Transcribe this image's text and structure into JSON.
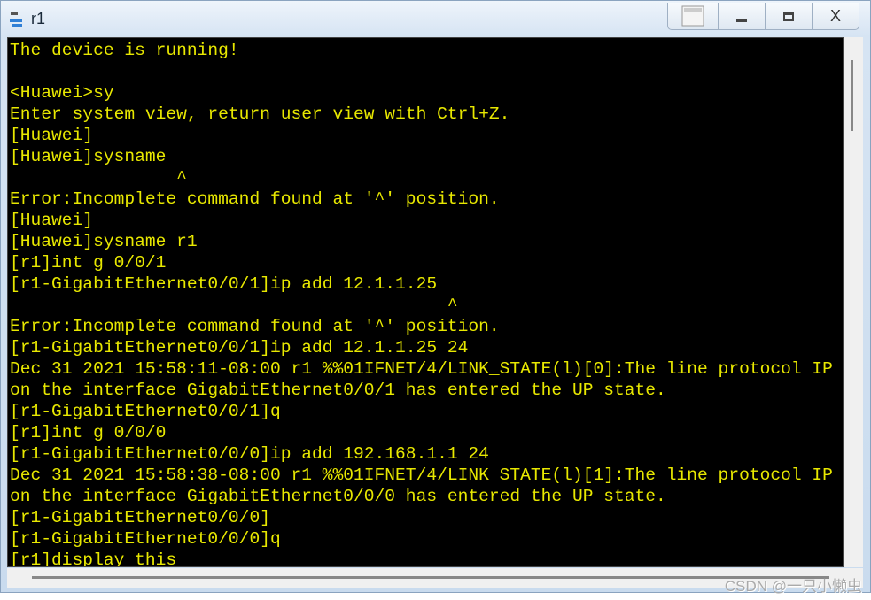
{
  "window": {
    "title": "r1",
    "controls": [
      "restore-layout",
      "_",
      "□",
      "X"
    ]
  },
  "terminal": {
    "lines": [
      "The device is running!",
      "",
      "<Huawei>sy",
      "Enter system view, return user view with Ctrl+Z.",
      "[Huawei]",
      "[Huawei]sysname",
      "                ^",
      "Error:Incomplete command found at '^' position.",
      "[Huawei]",
      "[Huawei]sysname r1",
      "[r1]int g 0/0/1",
      "[r1-GigabitEthernet0/0/1]ip add 12.1.1.25",
      "                                          ^",
      "Error:Incomplete command found at '^' position.",
      "[r1-GigabitEthernet0/0/1]ip add 12.1.1.25 24",
      "Dec 31 2021 15:58:11-08:00 r1 %%01IFNET/4/LINK_STATE(l)[0]:The line protocol IP",
      "on the interface GigabitEthernet0/0/1 has entered the UP state.",
      "[r1-GigabitEthernet0/0/1]q",
      "[r1]int g 0/0/0",
      "[r1-GigabitEthernet0/0/0]ip add 192.168.1.1 24",
      "Dec 31 2021 15:58:38-08:00 r1 %%01IFNET/4/LINK_STATE(l)[1]:The line protocol IP",
      "on the interface GigabitEthernet0/0/0 has entered the UP state.",
      "[r1-GigabitEthernet0/0/0]",
      "[r1-GigabitEthernet0/0/0]q",
      "[r1]display this"
    ]
  },
  "watermark": "CSDN @一只小懒虫"
}
